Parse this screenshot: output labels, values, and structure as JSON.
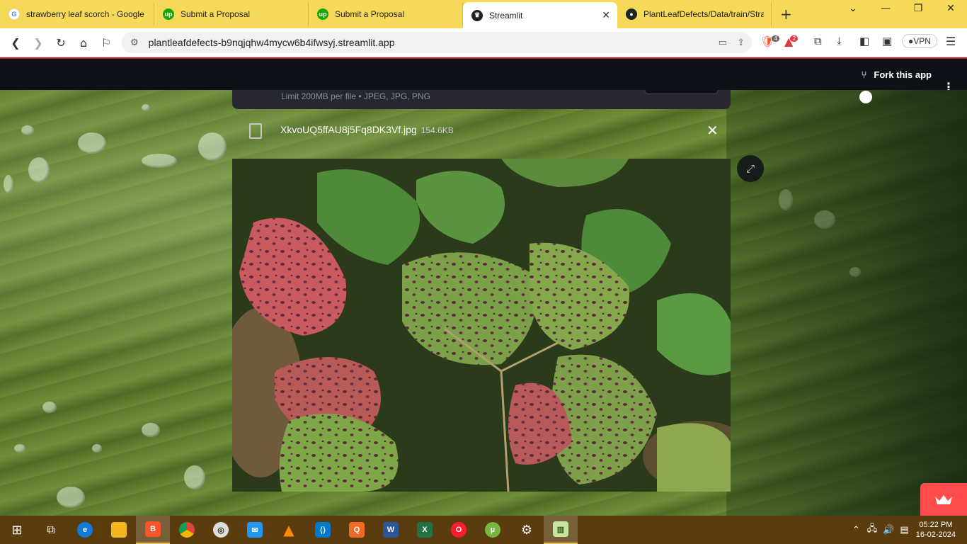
{
  "browser": {
    "tabs": [
      {
        "title": "strawberry leaf scorch - Google S",
        "icon": "google-icon",
        "active": false
      },
      {
        "title": "Submit a Proposal",
        "icon": "upwork-icon",
        "active": false
      },
      {
        "title": "Submit a Proposal",
        "icon": "upwork-icon",
        "active": false
      },
      {
        "title": "Streamlit",
        "icon": "streamlit-icon",
        "active": true
      },
      {
        "title": "PlantLeafDefects/Data/train/Stra",
        "icon": "github-icon",
        "active": false
      }
    ],
    "url": "plantleafdefects-b9nqjqhw4mycw6b4ifwsyj.streamlit.app",
    "vpn_label": "VPN",
    "brave_badge": "4",
    "rewards_badge": "2"
  },
  "app": {
    "fork_label": "Fork this app",
    "uploader_limit": "Limit 200MB per file • JPEG, JPG, PNG",
    "file_name": "XkvoUQ5ffAU8j5Fq8DK3Vf.jpg",
    "file_size": "154.6KB",
    "accent_color": "#ff4b4b"
  },
  "taskbar": {
    "time": "05:22 PM",
    "date": "16-02-2024",
    "apps": [
      "start",
      "task-view",
      "edge",
      "file-explorer",
      "brave",
      "chrome",
      "media-player",
      "messenger",
      "vlc",
      "vscode",
      "q-app",
      "word",
      "excel",
      "opera",
      "utorrent",
      "settings",
      "notepad-chart"
    ]
  }
}
